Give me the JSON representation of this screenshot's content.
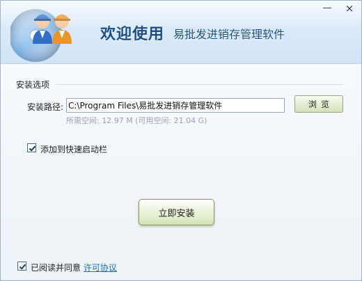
{
  "window": {
    "minimize_glyph": "—",
    "close_glyph": "×"
  },
  "header": {
    "welcome": "欢迎使用",
    "app_name": "易批发进销存管理软件",
    "logo_icon": "installer-disc-users-icon"
  },
  "options": {
    "section_title": "安装选项",
    "path_label": "安装路径:",
    "path_value": "C:\\Program Files\\易批发进销存管理软件",
    "browse_label": "浏览",
    "space_info": "所需空间: 12.97 M (可用空间: 21.04 G)",
    "quick_launch_label": "添加到快速启动栏",
    "quick_launch_checked": true
  },
  "actions": {
    "install_label": "立即安装"
  },
  "agreement": {
    "text": "已阅读并同意",
    "link": "许可协议",
    "checked": true
  },
  "colors": {
    "accent": "#1a4e86",
    "link": "#1a6fb8",
    "button_green": "#d3e4b6"
  }
}
